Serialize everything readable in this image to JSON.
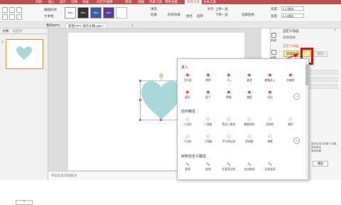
{
  "colors": {
    "accent": "#c0504d",
    "highlight": "#e01010",
    "heart": "#a8d8d9",
    "add_effect_bg": "#fdeaa8"
  },
  "top_tabs": [
    "开始",
    "插入",
    "设计",
    "切换",
    "动画",
    "幻灯片放映",
    "审阅",
    "视图",
    "开发工具",
    "特色功能",
    "绘图工具",
    "文本工具"
  ],
  "top_tabs_active_index": 10,
  "ribbon": {
    "edit_shape": "编辑形状",
    "text_box": "文本框",
    "style_label": "Abc",
    "fill": "填充",
    "outline": "轮廓",
    "shape_effect": "形状效果",
    "group": "组合",
    "rotate": "旋转",
    "align": "对齐",
    "up_layer": "上移一层",
    "down_layer": "下移一层",
    "selection_pane": "选择窗格",
    "height_label": "高度:",
    "height_value": "5.13厘米",
    "width_label": "宽度:",
    "width_value": "5.39厘米"
  },
  "doc_tabs": {
    "home": "我的WPS",
    "file": "新建 PPT 演示文稿.pptx *",
    "plus": "+"
  },
  "left_panel": {
    "tab_outline": "大纲",
    "tab_slides": "幻灯片",
    "slide_number": "1",
    "add": "+"
  },
  "notes_placeholder": "单击此处添加备注",
  "right_panel": {
    "title": "自定义动画",
    "close": "×",
    "select_pane": "选择窗格",
    "custom_anim": "自定义动画",
    "add_effect": "添加效果",
    "delete": "删除",
    "vtab_new": "新建",
    "vtab_anim": "动画",
    "side_note_1": "选中幻灯片的某个元素，然后单击",
    "side_note_2": "添加效果",
    "play": "播放"
  },
  "popup": {
    "sections": [
      {
        "title": "进入",
        "items": [
          "百叶窗",
          "擦除",
          "飞入",
          "盒状",
          "缓慢进入",
          "阶梯状",
          "菱形",
          "轮子",
          "劈裂",
          "棋盘",
          "切出"
        ],
        "glyph": "★",
        "tone": "red"
      },
      {
        "title": "动作路径",
        "items": [
          "八边形",
          "八角星",
          "等边三角形",
          "橄榄球形",
          "泪滴形",
          "菱形",
          "六边形",
          "六角星",
          "平行四边形",
          "四角星",
          "弹簧"
        ],
        "glyph": "☆",
        "tone": "blue"
      },
      {
        "title": "绘制自定义路径",
        "items": [
          "直线",
          "曲线",
          "任意多边形",
          "自由曲线",
          "无效选项"
        ],
        "glyph": "∿",
        "tone": "blue"
      }
    ],
    "more": "⌄"
  }
}
